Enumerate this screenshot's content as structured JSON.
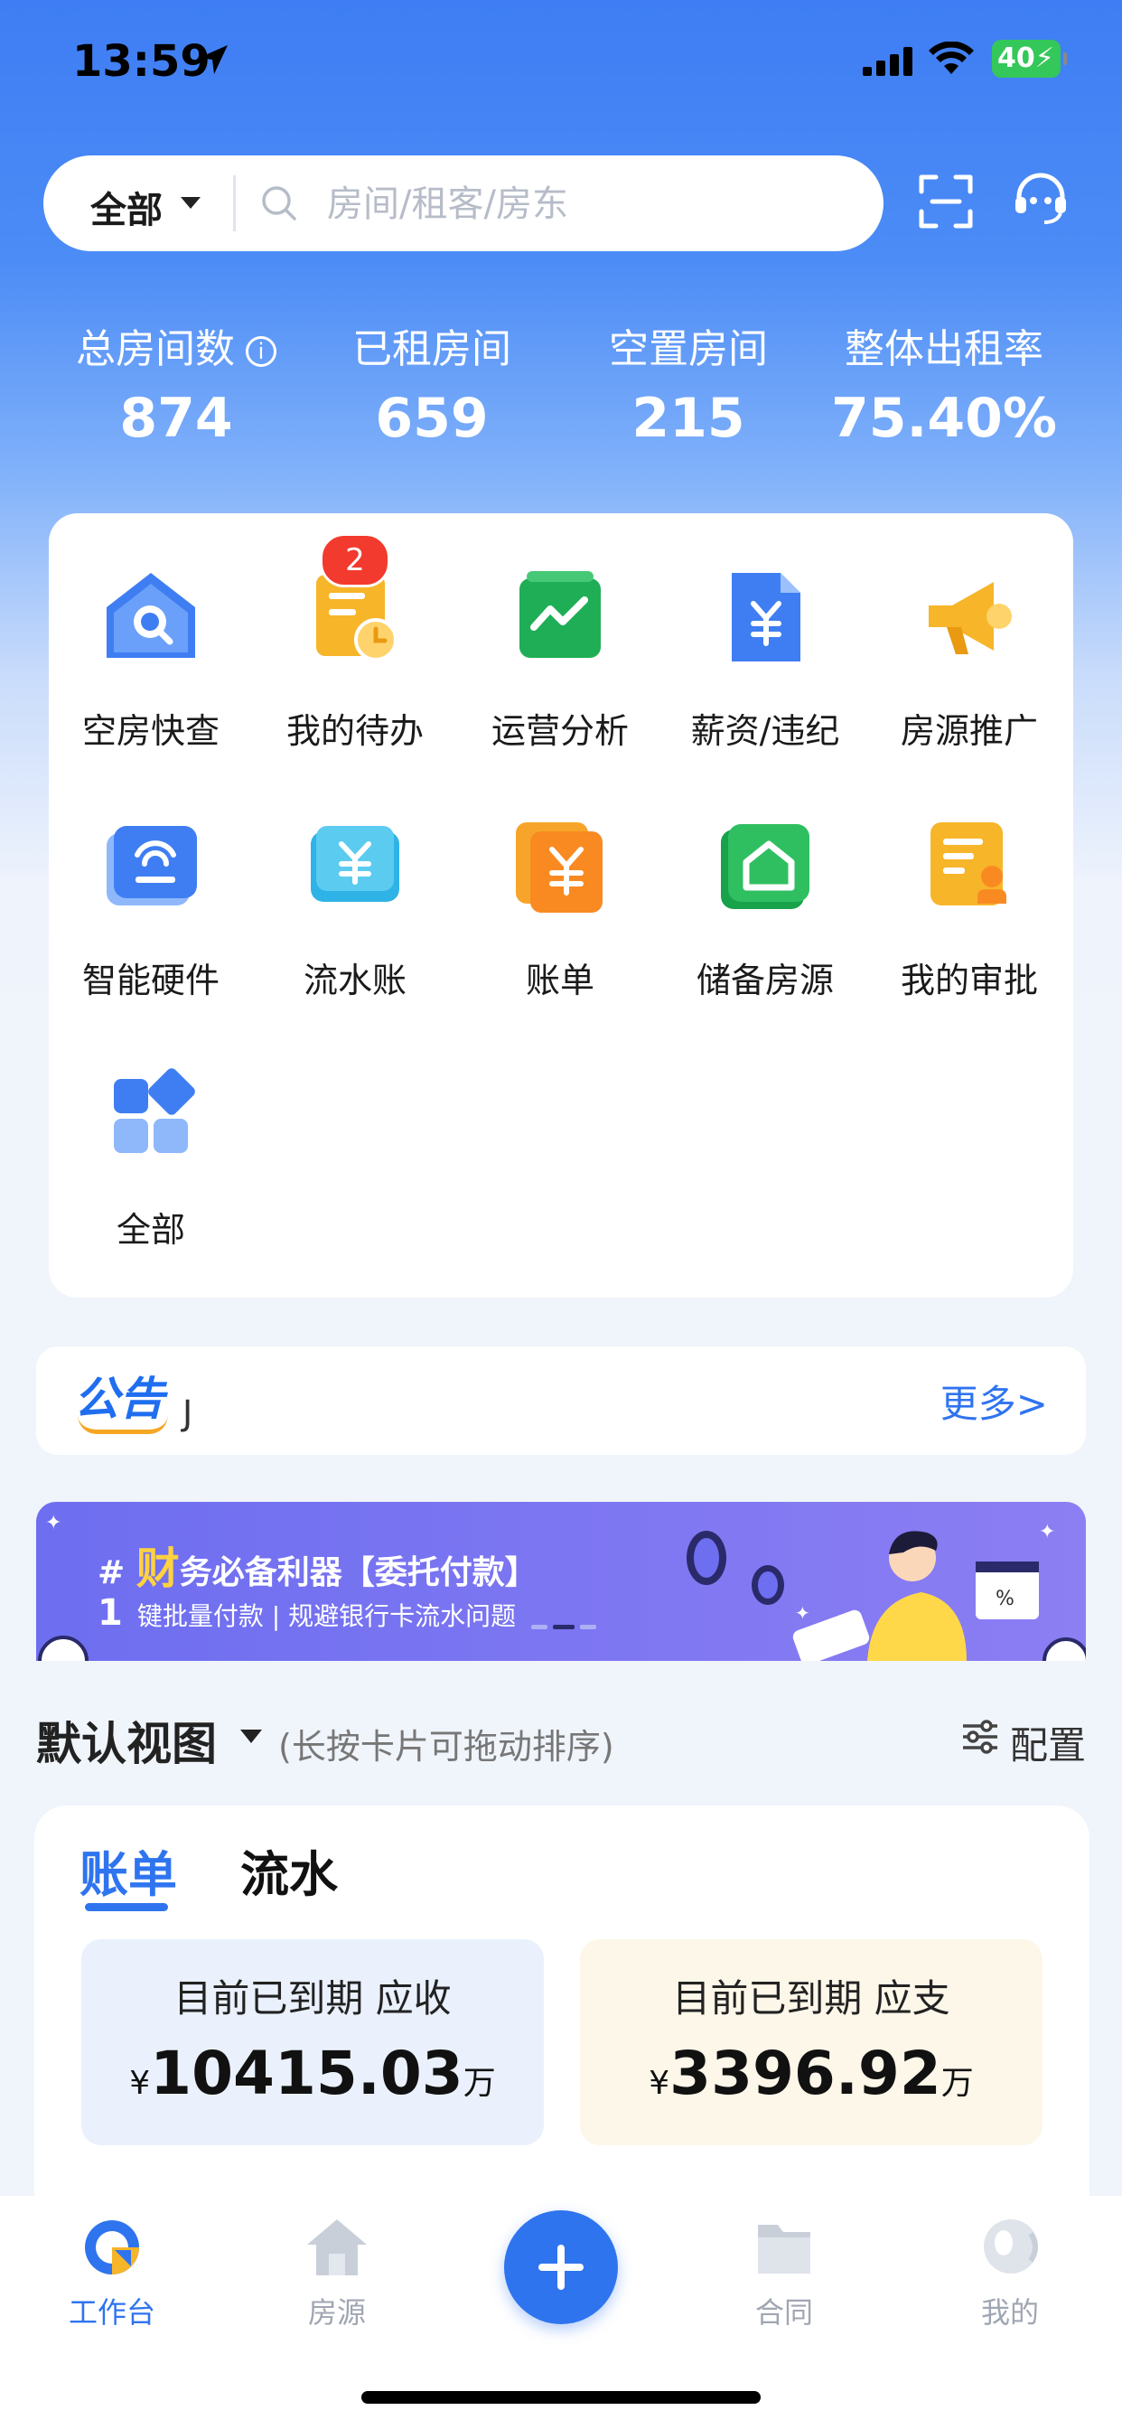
{
  "status": {
    "time": "13:59",
    "battery": "40"
  },
  "search": {
    "scope": "全部",
    "placeholder": "房间/租客/房东"
  },
  "stats": [
    {
      "label": "总房间数",
      "value": "874"
    },
    {
      "label": "已租房间",
      "value": "659"
    },
    {
      "label": "空置房间",
      "value": "215"
    },
    {
      "label": "整体出租率",
      "value": "75.40%"
    }
  ],
  "menu": {
    "items": [
      {
        "label": "空房快查",
        "icon": "house-search-icon"
      },
      {
        "label": "我的待办",
        "icon": "todo-clock-icon",
        "badge": "2"
      },
      {
        "label": "运营分析",
        "icon": "trend-chart-icon"
      },
      {
        "label": "薪资/违纪",
        "icon": "salary-doc-icon"
      },
      {
        "label": "房源推广",
        "icon": "megaphone-icon"
      },
      {
        "label": "智能硬件",
        "icon": "smart-device-icon"
      },
      {
        "label": "流水账",
        "icon": "ledger-icon"
      },
      {
        "label": "账单",
        "icon": "bill-icon"
      },
      {
        "label": "储备房源",
        "icon": "reserve-house-icon"
      },
      {
        "label": "我的审批",
        "icon": "approval-icon"
      },
      {
        "label": "全部",
        "icon": "all-apps-icon"
      }
    ]
  },
  "notice": {
    "logo": "公告",
    "text": "J",
    "more": "更多>"
  },
  "banner": {
    "hash": "#",
    "big_char": "财",
    "title_rest": "务必备利器【委托付款】",
    "num": "1",
    "subtitle": "键批量付款 | 规避银行卡流水问题"
  },
  "view": {
    "title": "默认视图",
    "hint": "(长按卡片可拖动排序)",
    "config": "配置"
  },
  "card": {
    "tabs": [
      "账单",
      "流水"
    ],
    "receivable": {
      "title": "目前已到期 应收",
      "currency": "¥",
      "amount": "10415.03",
      "unit": "万"
    },
    "payable": {
      "title": "目前已到期 应支",
      "currency": "¥",
      "amount": "3396.92",
      "unit": "万"
    }
  },
  "tabbar": {
    "items": [
      "工作台",
      "房源",
      "合同",
      "我的"
    ]
  },
  "colors": {
    "accent": "#2f74ef",
    "badge": "#f33a2e",
    "banner": "#7473f1",
    "receivable_bg": "#eaf1fc",
    "payable_bg": "#fdf7e9"
  }
}
